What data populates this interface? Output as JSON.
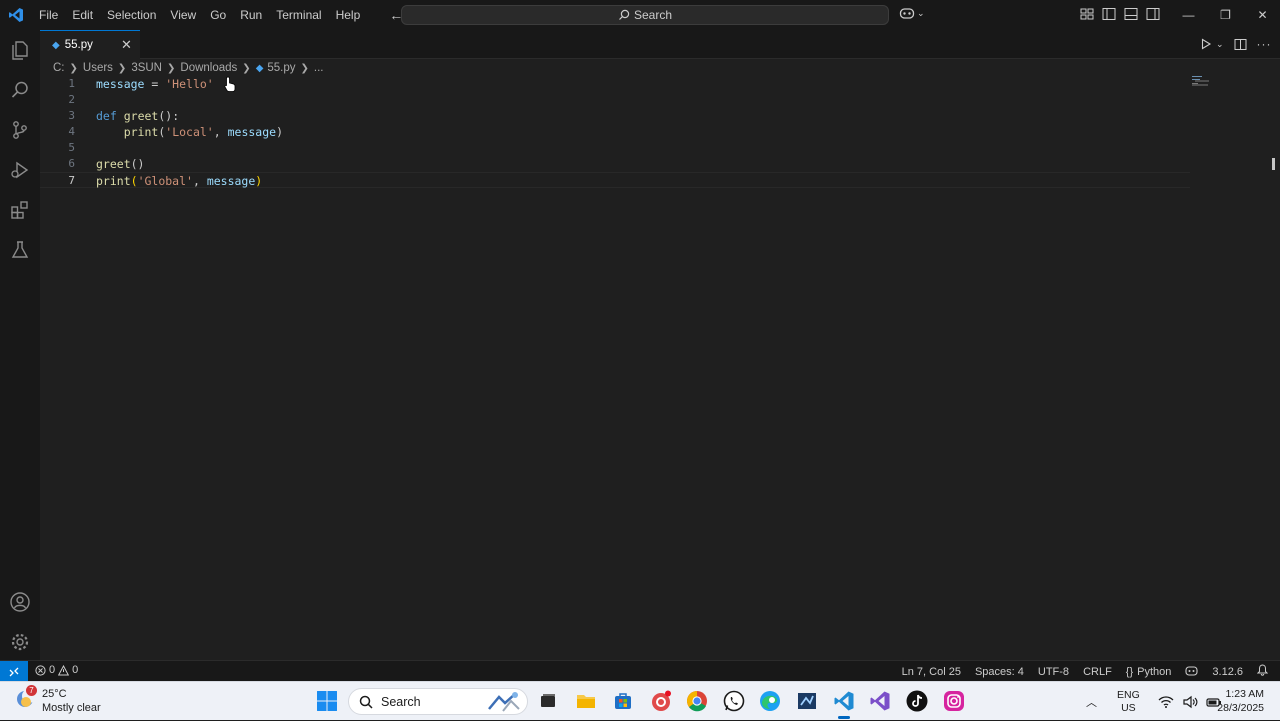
{
  "titlebar": {
    "menu": [
      "File",
      "Edit",
      "Selection",
      "View",
      "Go",
      "Run",
      "Terminal",
      "Help"
    ],
    "search_label": "Search"
  },
  "tab": {
    "label": "55.py"
  },
  "breadcrumb": {
    "items": [
      "C:",
      "Users",
      "3SUN",
      "Downloads"
    ],
    "file": "55.py",
    "more": "..."
  },
  "editor": {
    "line_numbers": [
      "1",
      "2",
      "3",
      "4",
      "5",
      "6",
      "7"
    ],
    "lines": [
      {
        "t1": "message",
        "t2": " = ",
        "t3": "'Hello'"
      },
      {},
      {
        "t1": "def",
        "t2": " ",
        "t3": "greet",
        "t4": "():"
      },
      {
        "t1": "    ",
        "t2": "print",
        "t3": "(",
        "t4": "'Local'",
        "t5": ", ",
        "t6": "message",
        "t7": ")"
      },
      {},
      {
        "t1": "greet",
        "t2": "()"
      },
      {
        "t1": "print",
        "t2": "(",
        "t3": "'Global'",
        "t4": ", ",
        "t5": "message",
        "t6": ")"
      }
    ]
  },
  "statusbar": {
    "errors": "0",
    "warnings": "0",
    "position": "Ln 7, Col 25",
    "spaces": "Spaces: 4",
    "encoding": "UTF-8",
    "eol": "CRLF",
    "language": "Python",
    "python_version": "3.12.6"
  },
  "taskbar": {
    "weather_badge": "7",
    "temperature": "25°C",
    "condition": "Mostly clear",
    "search_label": "Search",
    "lang_top": "ENG",
    "lang_bottom": "US",
    "time": "1:23 AM",
    "date": "28/3/2025"
  },
  "colors": {
    "accent": "#0078d4",
    "keyword": "#569cd6",
    "function": "#dcdcaa",
    "string": "#ce9178",
    "variable": "#9cdcfe"
  }
}
